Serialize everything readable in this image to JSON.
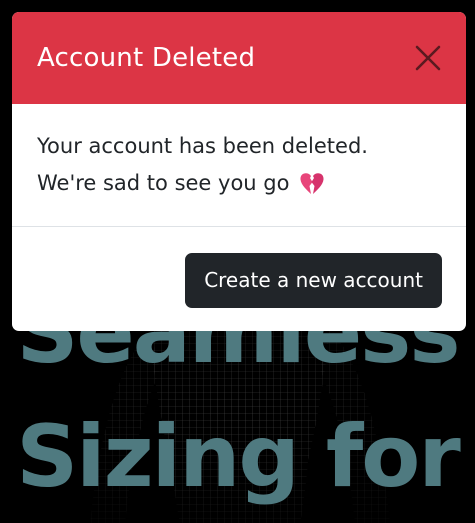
{
  "background": {
    "headline_line1": "Seamless",
    "headline_line2": "Sizing for"
  },
  "modal": {
    "title": "Account Deleted",
    "close_icon": "close-icon",
    "body_line1": "Your account has been deleted.",
    "body_line2": "We're sad to see you go",
    "heart_icon": "broken-heart-icon",
    "button_label": "Create a new account"
  },
  "colors": {
    "header": "#dc3545",
    "button": "#212529",
    "headline": "#4f7a80"
  }
}
